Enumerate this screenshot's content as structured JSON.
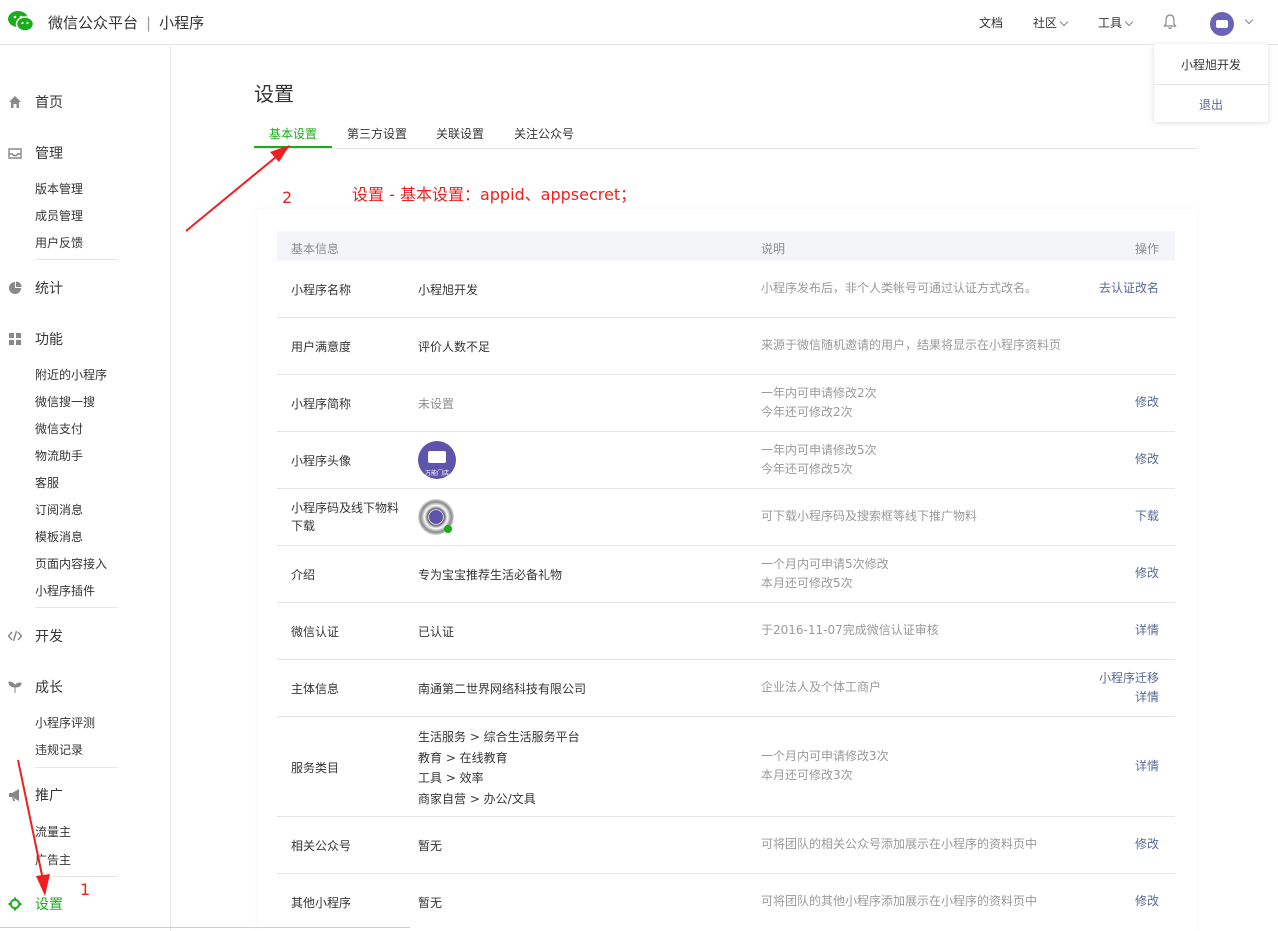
{
  "header": {
    "brand": "微信公众平台",
    "separator": "|",
    "product": "小程序",
    "nav": {
      "docs": "文档",
      "community": "社区",
      "tools": "工具"
    },
    "user_menu": {
      "name": "小程旭开发",
      "logout": "退出"
    }
  },
  "sidebar": {
    "home": "首页",
    "manage": {
      "label": "管理",
      "items": [
        "版本管理",
        "成员管理",
        "用户反馈"
      ]
    },
    "stats": "统计",
    "features": {
      "label": "功能",
      "items": [
        "附近的小程序",
        "微信搜一搜",
        "微信支付",
        "物流助手",
        "客服",
        "订阅消息",
        "模板消息",
        "页面内容接入",
        "小程序插件"
      ]
    },
    "dev": "开发",
    "growth": {
      "label": "成长",
      "items": [
        "小程序评测",
        "违规记录"
      ]
    },
    "promo": {
      "label": "推广",
      "items": [
        "流量主",
        "广告主"
      ]
    },
    "settings": "设置"
  },
  "page": {
    "title": "设置",
    "tabs": [
      "基本设置",
      "第三方设置",
      "关联设置",
      "关注公众号"
    ]
  },
  "annotations": {
    "num2": "2",
    "note": "设置 - 基本设置：appid、appsecret；",
    "num1": "1"
  },
  "table": {
    "headers": {
      "info": "基本信息",
      "desc": "说明",
      "action": "操作"
    },
    "rows": [
      {
        "label": "小程序名称",
        "value": "小程旭开发",
        "desc": [
          "小程序发布后，非个人类帐号可通过认证方式改名。"
        ],
        "actions": [
          "去认证改名"
        ]
      },
      {
        "label": "用户满意度",
        "value": "评价人数不足",
        "desc": [
          "来源于微信随机邀请的用户，结果将显示在小程序资料页"
        ],
        "actions": []
      },
      {
        "label": "小程序简称",
        "value": "未设置",
        "desc": [
          "一年内可申请修改2次",
          "今年还可修改2次"
        ],
        "actions": [
          "修改"
        ]
      },
      {
        "label": "小程序头像",
        "value": "",
        "avatar_caption": "万能门店",
        "desc": [
          "一年内可申请修改5次",
          "今年还可修改5次"
        ],
        "actions": [
          "修改"
        ]
      },
      {
        "label": "小程序码及线下物料下载",
        "value": "",
        "desc": [
          "可下载小程序码及搜索框等线下推广物料"
        ],
        "actions": [
          "下载"
        ]
      },
      {
        "label": "介绍",
        "value": "专为宝宝推荐生活必备礼物",
        "desc": [
          "一个月内可申请5次修改",
          "本月还可修改5次"
        ],
        "actions": [
          "修改"
        ]
      },
      {
        "label": "微信认证",
        "value": "已认证",
        "desc": [
          "于2016-11-07完成微信认证审核"
        ],
        "actions": [
          "详情"
        ]
      },
      {
        "label": "主体信息",
        "value": "南通第二世界网络科技有限公司",
        "desc": [
          "企业法人及个体工商户"
        ],
        "actions": [
          "小程序迁移",
          "详情"
        ]
      },
      {
        "label": "服务类目",
        "values": [
          "生活服务 > 综合生活服务平台",
          "教育 > 在线教育",
          "工具 > 效率",
          "商家自营 > 办公/文具"
        ],
        "desc": [
          "一个月内可申请修改3次",
          "本月还可修改3次"
        ],
        "actions": [
          "详情"
        ]
      },
      {
        "label": "相关公众号",
        "value": "暂无",
        "desc": [
          "可将团队的相关公众号添加展示在小程序的资料页中"
        ],
        "actions": [
          "修改"
        ]
      },
      {
        "label": "其他小程序",
        "value": "暂无",
        "desc": [
          "可将团队的其他小程序添加展示在小程序的资料页中"
        ],
        "actions": [
          "修改"
        ]
      }
    ]
  },
  "colors": {
    "accent": "#1aad19",
    "link": "#576b95",
    "annotation": "#f01f1f"
  }
}
